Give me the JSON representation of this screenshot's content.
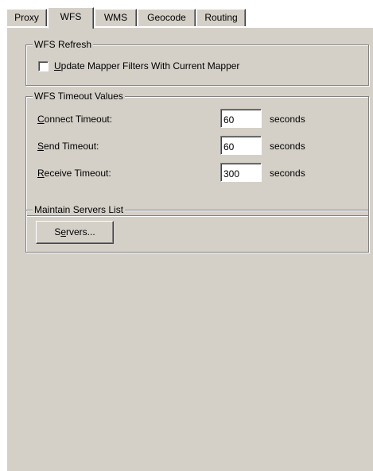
{
  "tabs": [
    {
      "label": "Proxy",
      "active": false
    },
    {
      "label": "WFS",
      "active": true
    },
    {
      "label": "WMS",
      "active": false
    },
    {
      "label": "Geocode",
      "active": false
    },
    {
      "label": "Routing",
      "active": false
    }
  ],
  "wfs_refresh": {
    "legend": "WFS Refresh",
    "checkbox": {
      "label_first": "U",
      "label_rest": "pdate Mapper Filters With Current Mapper",
      "checked": false
    }
  },
  "timeouts": {
    "legend": "WFS Timeout Values",
    "unit": "seconds",
    "connect": {
      "label_first": "C",
      "label_rest": "onnect Timeout:",
      "value": "60"
    },
    "send": {
      "label_first": "S",
      "label_rest": "end Timeout:",
      "value": "60"
    },
    "receive": {
      "label_first": "R",
      "label_rest": "eceive Timeout:",
      "value": "300"
    }
  },
  "servers": {
    "legend": "Maintain Servers List",
    "button": {
      "label_first": "S",
      "label_mid": "e",
      "label_rest": "rvers..."
    }
  }
}
